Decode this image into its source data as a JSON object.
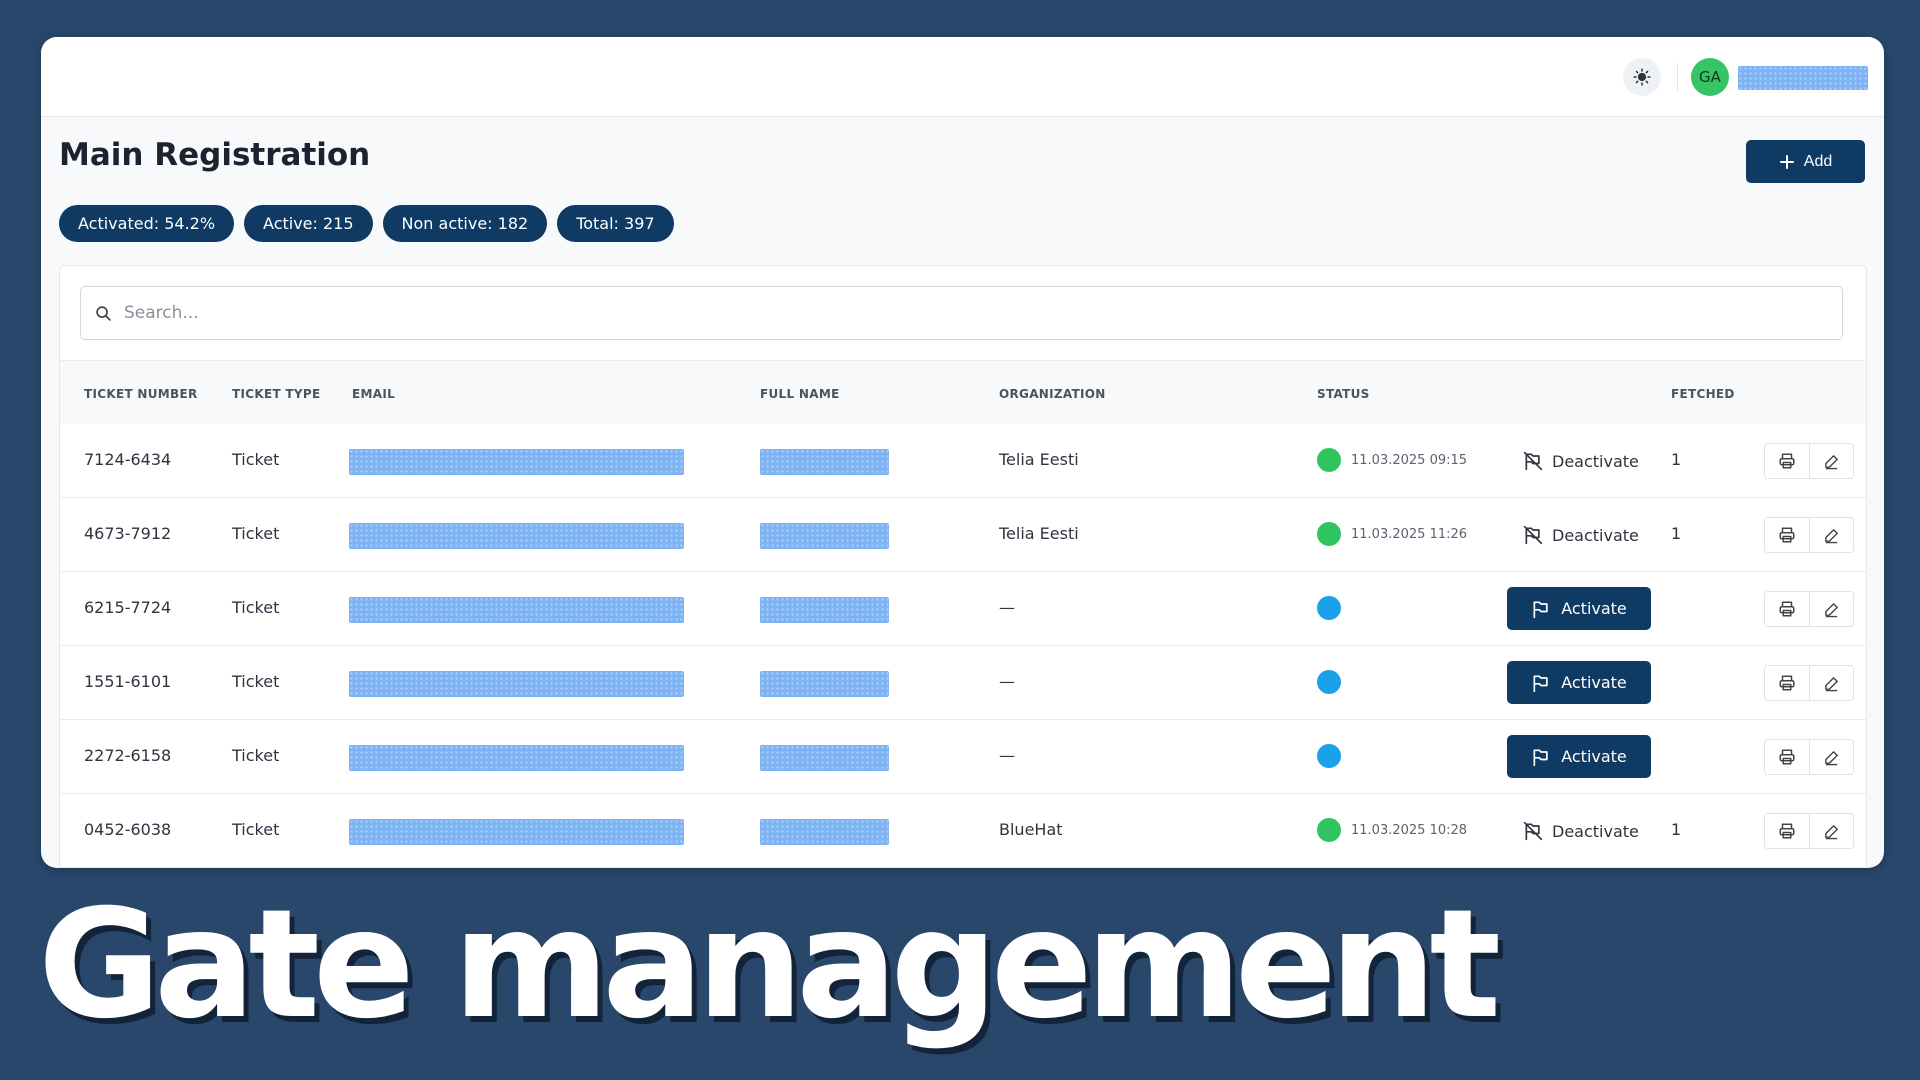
{
  "header": {
    "avatar_initials": "GA",
    "theme_icon": "sun-icon"
  },
  "page": {
    "title": "Main Registration",
    "add_label": "Add"
  },
  "stats": [
    {
      "label": "Activated: 54.2%"
    },
    {
      "label": "Active: 215"
    },
    {
      "label": "Non active: 182"
    },
    {
      "label": "Total: 397"
    }
  ],
  "search": {
    "placeholder": "Search..."
  },
  "columns": {
    "ticket_number": "TICKET NUMBER",
    "ticket_type": "TICKET TYPE",
    "email": "EMAIL",
    "full_name": "FULL NAME",
    "organization": "ORGANIZATION",
    "status": "STATUS",
    "fetched": "FETCHED"
  },
  "actions": {
    "deactivate_label": "Deactivate",
    "activate_label": "Activate"
  },
  "rows": [
    {
      "ticket_number": "7124-6434",
      "ticket_type": "Ticket",
      "organization": "Telia Eesti",
      "status": "active",
      "status_time": "11.03.2025 09:15",
      "fetched": "1"
    },
    {
      "ticket_number": "4673-7912",
      "ticket_type": "Ticket",
      "organization": "Telia Eesti",
      "status": "active",
      "status_time": "11.03.2025 11:26",
      "fetched": "1"
    },
    {
      "ticket_number": "6215-7724",
      "ticket_type": "Ticket",
      "organization": "—",
      "status": "inactive",
      "status_time": "",
      "fetched": ""
    },
    {
      "ticket_number": "1551-6101",
      "ticket_type": "Ticket",
      "organization": "—",
      "status": "inactive",
      "status_time": "",
      "fetched": ""
    },
    {
      "ticket_number": "2272-6158",
      "ticket_type": "Ticket",
      "organization": "—",
      "status": "inactive",
      "status_time": "",
      "fetched": ""
    },
    {
      "ticket_number": "0452-6038",
      "ticket_type": "Ticket",
      "organization": "BlueHat",
      "status": "active",
      "status_time": "11.03.2025 10:28",
      "fetched": "1"
    }
  ],
  "colors": {
    "primary": "#0e3a63",
    "background": "#29466b",
    "status_active": "#2fc45f",
    "status_inactive": "#1ba1ea"
  },
  "caption": "Gate management"
}
